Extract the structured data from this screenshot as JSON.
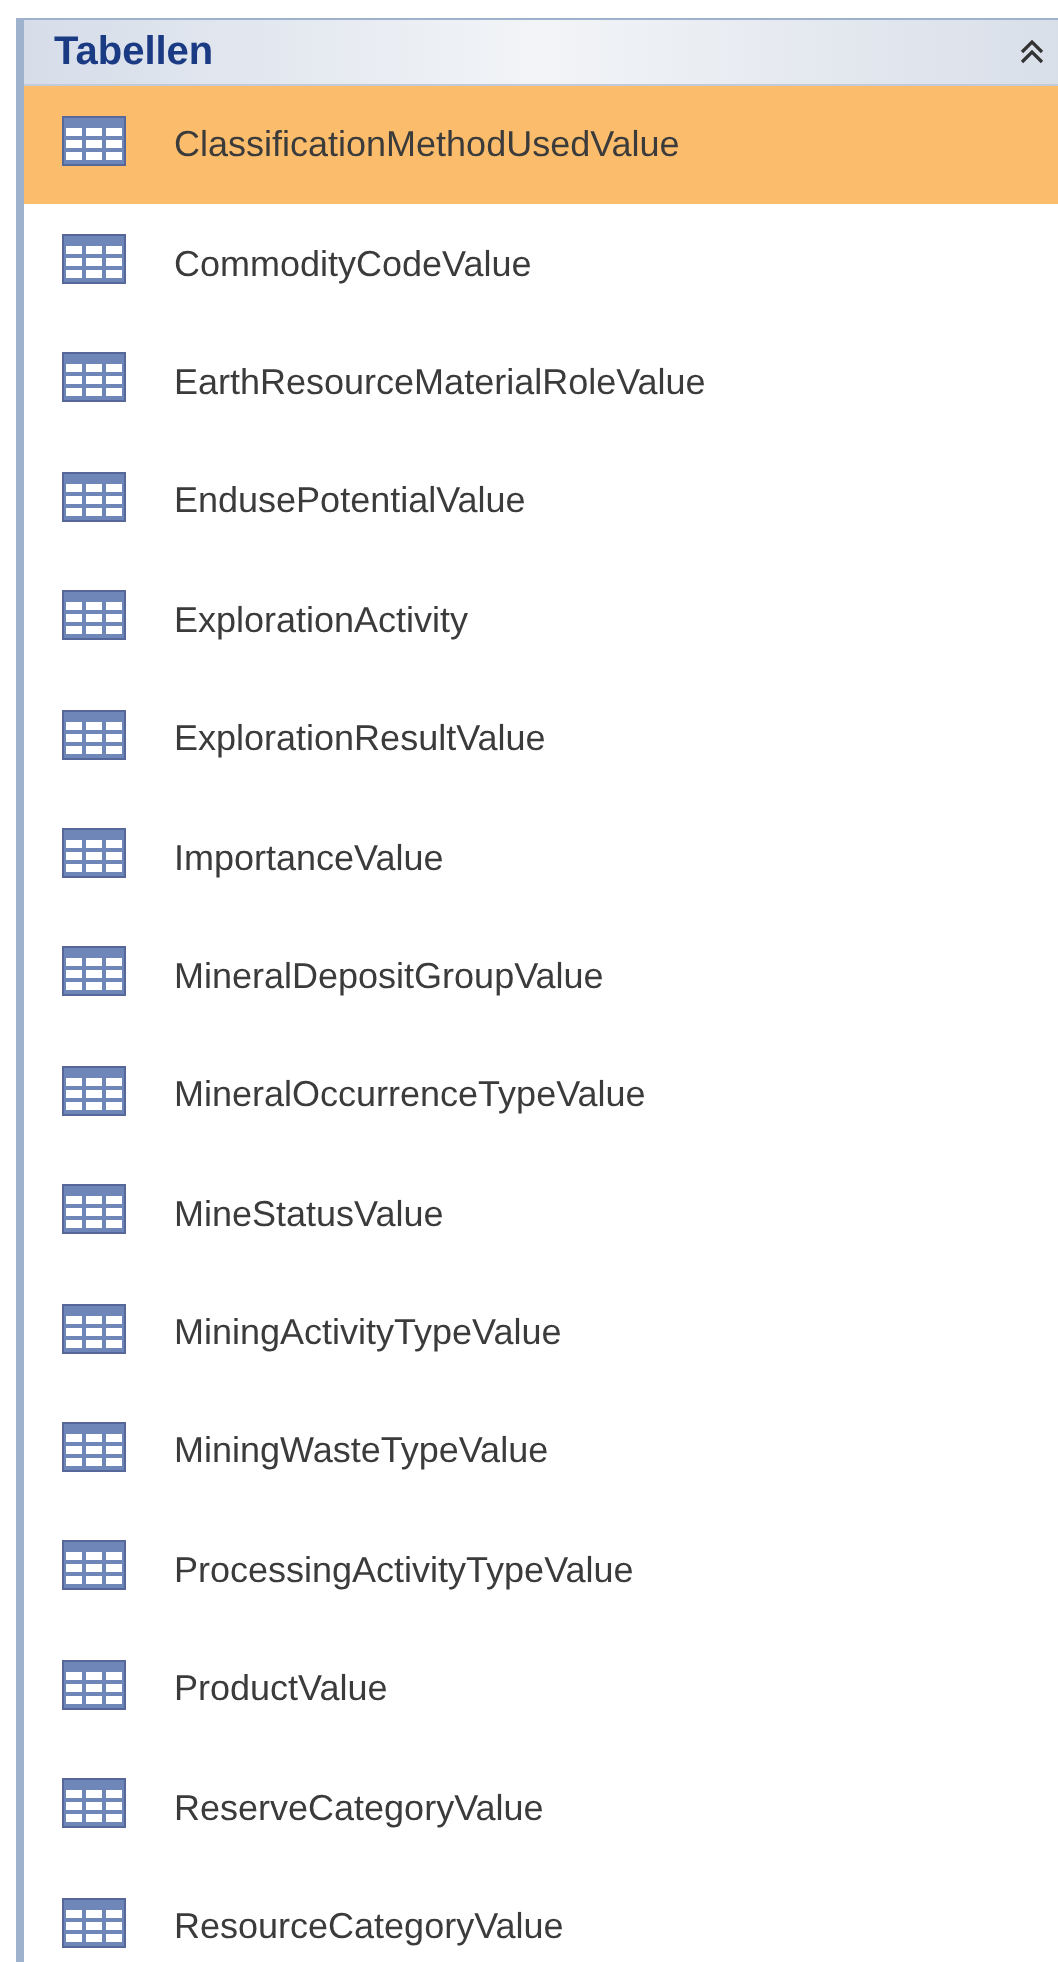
{
  "group": {
    "title": "Tabellen",
    "expanded": true
  },
  "items": [
    {
      "label": "ClassificationMethodUsedValue",
      "selected": true
    },
    {
      "label": "CommodityCodeValue",
      "selected": false
    },
    {
      "label": "EarthResourceMaterialRoleValue",
      "selected": false
    },
    {
      "label": "EndusePotentialValue",
      "selected": false
    },
    {
      "label": "ExplorationActivity",
      "selected": false
    },
    {
      "label": "ExplorationResultValue",
      "selected": false
    },
    {
      "label": "ImportanceValue",
      "selected": false
    },
    {
      "label": "MineralDepositGroupValue",
      "selected": false
    },
    {
      "label": "MineralOccurrenceTypeValue",
      "selected": false
    },
    {
      "label": "MineStatusValue",
      "selected": false
    },
    {
      "label": "MiningActivityTypeValue",
      "selected": false
    },
    {
      "label": "MiningWasteTypeValue",
      "selected": false
    },
    {
      "label": "ProcessingActivityTypeValue",
      "selected": false
    },
    {
      "label": "ProductValue",
      "selected": false
    },
    {
      "label": "ReserveCategoryValue",
      "selected": false
    },
    {
      "label": "ResourceCategoryValue",
      "selected": false
    }
  ]
}
